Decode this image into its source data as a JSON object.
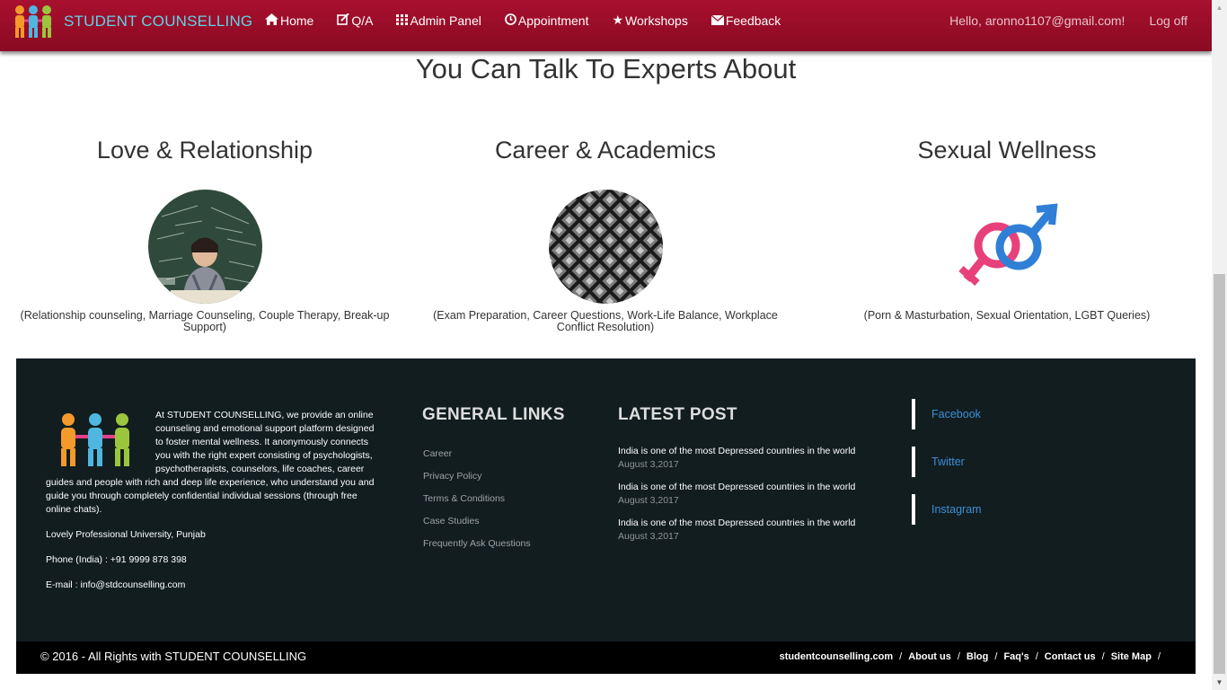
{
  "navbar": {
    "brand": "STUDENT COUNSELLING",
    "items": [
      {
        "label": "Home",
        "icon": "home-icon"
      },
      {
        "label": "Q/A",
        "icon": "edit-icon"
      },
      {
        "label": "Admin Panel",
        "icon": "grid-icon"
      },
      {
        "label": "Appointment",
        "icon": "clock-icon"
      },
      {
        "label": "Workshops",
        "icon": "star-icon"
      },
      {
        "label": "Feedback",
        "icon": "envelope-icon"
      }
    ],
    "greeting": "Hello, aronno1107@gmail.com!",
    "logoff": "Log off"
  },
  "section": {
    "title": "You Can Talk To Experts About",
    "topics": [
      {
        "title": "Love & Relationship",
        "desc": "(Relationship counseling, Marriage Counseling, Couple Therapy, Break-up Support)",
        "image": "stressed-student-photo"
      },
      {
        "title": "Career & Academics",
        "desc": "(Exam Preparation, Career Questions, Work-Life Balance, Workplace Conflict Resolution)",
        "image": "abstract-pattern-photo"
      },
      {
        "title": "Sexual Wellness",
        "desc": "(Porn & Masturbation, Sexual Orientation, LGBT Queries)",
        "image": "gender-symbols-icon"
      }
    ]
  },
  "footer": {
    "about": "At STUDENT COUNSELLING, we provide an online counseling and emotional support platform designed to foster mental wellness. It anonymously connects you with the right expert consisting of psychologists, psychotherapists, counselors, life coaches, career guides and people with rich and deep life experience, who understand you and guide you through completely confidential individual sessions (through free online chats).",
    "address": "Lovely Professional University, Punjab",
    "phone": "Phone (India) : +91 9999 878 398",
    "email": "E-mail : info@stdcounselling.com",
    "general_links_title": "GENERAL LINKS",
    "general_links": [
      "Career",
      "Privacy Policy",
      "Terms & Conditions",
      "Case Studies",
      "Frequently Ask Questions"
    ],
    "latest_post_title": "LATEST POST",
    "posts": [
      {
        "title": "India is one of the most Depressed countries in the world",
        "date": "August 3,2017"
      },
      {
        "title": "India is one of the most Depressed countries in the world",
        "date": "August 3,2017"
      },
      {
        "title": "India is one of the most Depressed countries in the world",
        "date": "August 3,2017"
      }
    ],
    "social": [
      "Facebook",
      "Twitter",
      "Instagram"
    ]
  },
  "bottom": {
    "copyright": "© 2016 - All Rights with STUDENT COUNSELLING",
    "links": [
      "studentcounselling.com",
      "About us",
      "Blog",
      "Faq's",
      "Contact us",
      "Site Map"
    ],
    "separator": "/"
  },
  "colors": {
    "navbar": "#a8102f",
    "brand_text": "#5fd3e8",
    "footer_bg": "#121d20",
    "social_link": "#3d8fd4"
  }
}
